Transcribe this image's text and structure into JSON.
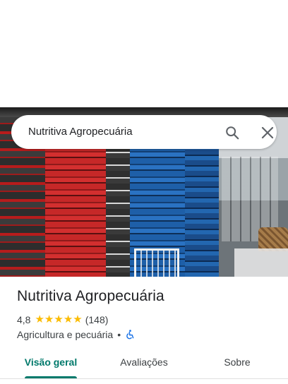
{
  "search": {
    "query": "Nutritiva Agropecuária",
    "search_icon": "search-icon",
    "close_icon": "close-icon"
  },
  "place": {
    "name": "Nutritiva Agropecuária",
    "rating": "4,8",
    "stars": 5,
    "review_count": "(148)",
    "category": "Agricultura e pecuária",
    "separator": "•",
    "accessibility_icon": "wheelchair-icon"
  },
  "tabs": [
    {
      "label": "Visão geral",
      "active": true
    },
    {
      "label": "Avaliações",
      "active": false
    },
    {
      "label": "Sobre",
      "active": false
    }
  ],
  "colors": {
    "accent": "#00796b",
    "star": "#fbbc04",
    "accessibility_icon": "#1a73e8"
  }
}
